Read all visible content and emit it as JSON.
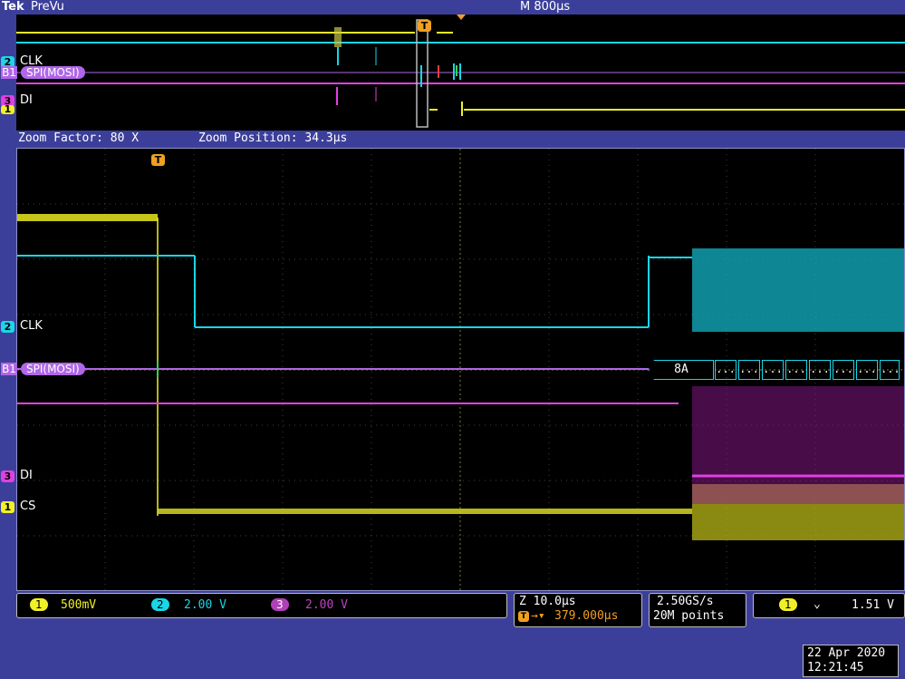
{
  "header": {
    "brand": "Tek",
    "mode": "PreVu",
    "timebase": "M 800µs"
  },
  "zoom": {
    "factor": "Zoom Factor: 80 X",
    "position": "Zoom Position: 34.3µs"
  },
  "channels": {
    "ch2": {
      "num": "2",
      "label": "CLK",
      "color": "#19d6e8"
    },
    "bus": {
      "num": "B1",
      "label": "SPI(MOSI)",
      "color": "#b066e8"
    },
    "ch3": {
      "num": "3",
      "label": "DI",
      "color": "#e040e0"
    },
    "ch1": {
      "num": "1",
      "label": "CS",
      "color": "#f0f028"
    }
  },
  "bus_decode": {
    "first_value": "8A",
    "packet_symbol": "..."
  },
  "trigger_marker": "T",
  "status": {
    "ch1_scale": "500mV",
    "ch2_scale": "2.00 V",
    "ch3_scale": "2.00 V",
    "zoom_time": "Z 10.0µs",
    "trigger_pos": "379.000µs",
    "sample_rate": "2.50GS/s",
    "record_length": "20M points",
    "trigger_slope": "⌄",
    "trigger_level": "1.51 V",
    "trigger_ch": "1"
  },
  "datetime": {
    "date": "22 Apr  2020",
    "time": "12:21:45"
  }
}
